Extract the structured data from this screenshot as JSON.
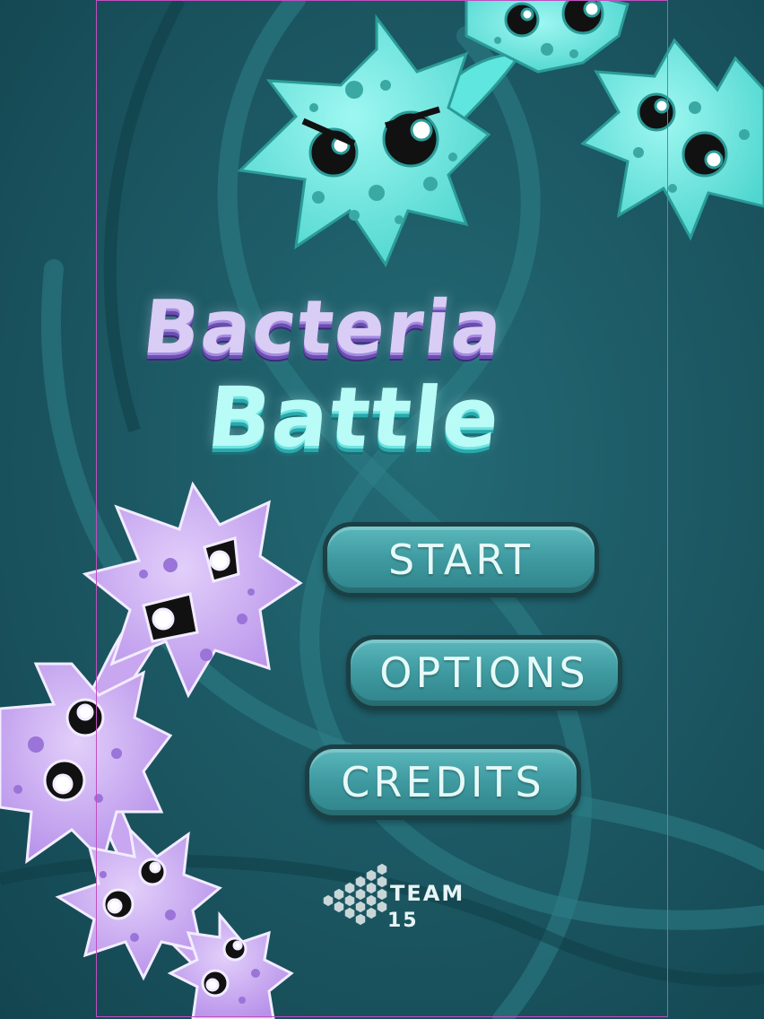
{
  "game": {
    "title_line1": "Bacteria",
    "title_line2": "Battle"
  },
  "menu": {
    "start_label": "START",
    "options_label": "OPTIONS",
    "credits_label": "CREDITS"
  },
  "team": {
    "word": "TEAM",
    "number": "15"
  },
  "colors": {
    "background": "#1d5a65",
    "cyan_bacteria": "#5ee6df",
    "purple_bacteria": "#c9a6f0",
    "button": "#3e9aa0",
    "title_purple": "#d9cdf6",
    "title_cyan": "#b9fbf6"
  }
}
